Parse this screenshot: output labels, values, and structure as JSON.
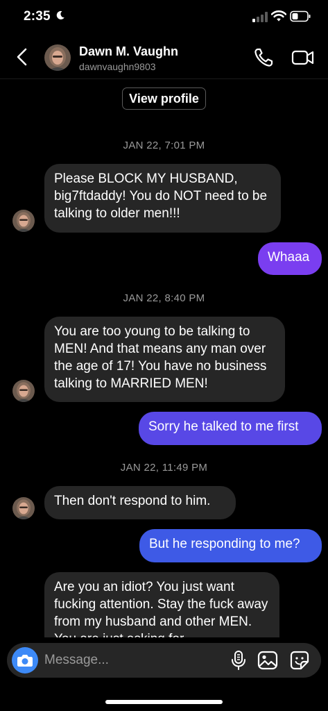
{
  "status_bar": {
    "time": "2:35"
  },
  "header": {
    "name": "Dawn M. Vaughn",
    "handle": "dawnvaughn9803"
  },
  "view_profile_label": "View profile",
  "colors": {
    "background": "#000000",
    "incoming_bubble": "#262626",
    "outgoing_purple": "#7a3ef0",
    "outgoing_indigo": "#5848e6",
    "outgoing_blue": "#3e5ae6",
    "camera_button": "#3d8af7",
    "secondary_text": "#9a9a9a"
  },
  "timestamps": [
    "JAN 22, 7:01 PM",
    "JAN 22, 8:40 PM",
    "JAN 22, 11:49 PM"
  ],
  "messages": [
    {
      "from": "them",
      "text": "Please BLOCK MY HUSBAND, big7ftdaddy! You do NOT need to be talking to older men!!!"
    },
    {
      "from": "me",
      "text": "Whaaa"
    },
    {
      "from": "them",
      "text": "You are too young to be talking to MEN! And that means any man over the age of 17! You have no business talking to MARRIED MEN!"
    },
    {
      "from": "me",
      "text": "Sorry he talked to me first"
    },
    {
      "from": "them",
      "text": "Then don't respond to him."
    },
    {
      "from": "me",
      "text": "But he responding to me?"
    },
    {
      "from": "them",
      "text": "Are you an idiot? You just want fucking attention. Stay the fuck away from my husband and other MEN. You are just asking for"
    }
  ],
  "composer": {
    "placeholder": "Message..."
  },
  "icons": {
    "back": "chevron-left-icon",
    "call": "phone-icon",
    "video": "video-camera-icon",
    "camera": "camera-icon",
    "mic": "microphone-icon",
    "gallery": "image-icon",
    "sticker": "sticker-icon"
  }
}
